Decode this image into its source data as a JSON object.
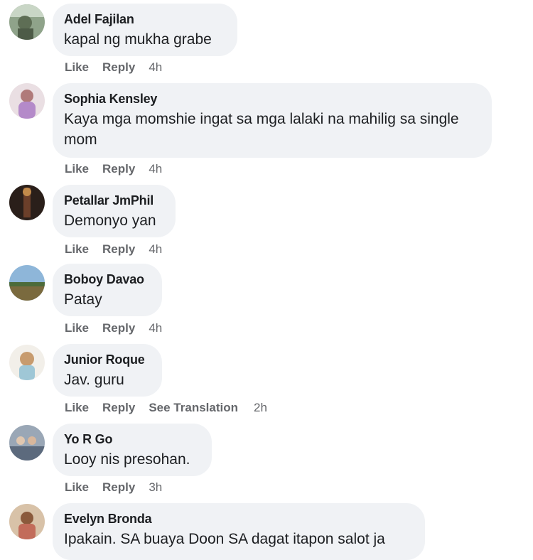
{
  "comments": [
    {
      "author": "Adel Fajilan",
      "text": "kapal ng mukha grabe",
      "like": "Like",
      "reply": "Reply",
      "time": "4h"
    },
    {
      "author": "Sophia Kensley",
      "text": "Kaya mga momshie ingat sa mga lalaki na mahilig sa single mom",
      "like": "Like",
      "reply": "Reply",
      "time": "4h"
    },
    {
      "author": "Petallar JmPhil",
      "text": "Demonyo yan",
      "like": "Like",
      "reply": "Reply",
      "time": "4h"
    },
    {
      "author": "Boboy Davao",
      "text": "Patay",
      "like": "Like",
      "reply": "Reply",
      "time": "4h"
    },
    {
      "author": "Junior Roque",
      "text": "Jav. guru",
      "like": "Like",
      "reply": "Reply",
      "see_translation": "See Translation",
      "time": "2h"
    },
    {
      "author": "Yo R Go",
      "text": "Looy nis presohan.",
      "like": "Like",
      "reply": "Reply",
      "time": "3h"
    },
    {
      "author": "Evelyn Bronda",
      "text": "Ipakain. SA buaya Doon SA dagat itapon salot ja"
    }
  ]
}
